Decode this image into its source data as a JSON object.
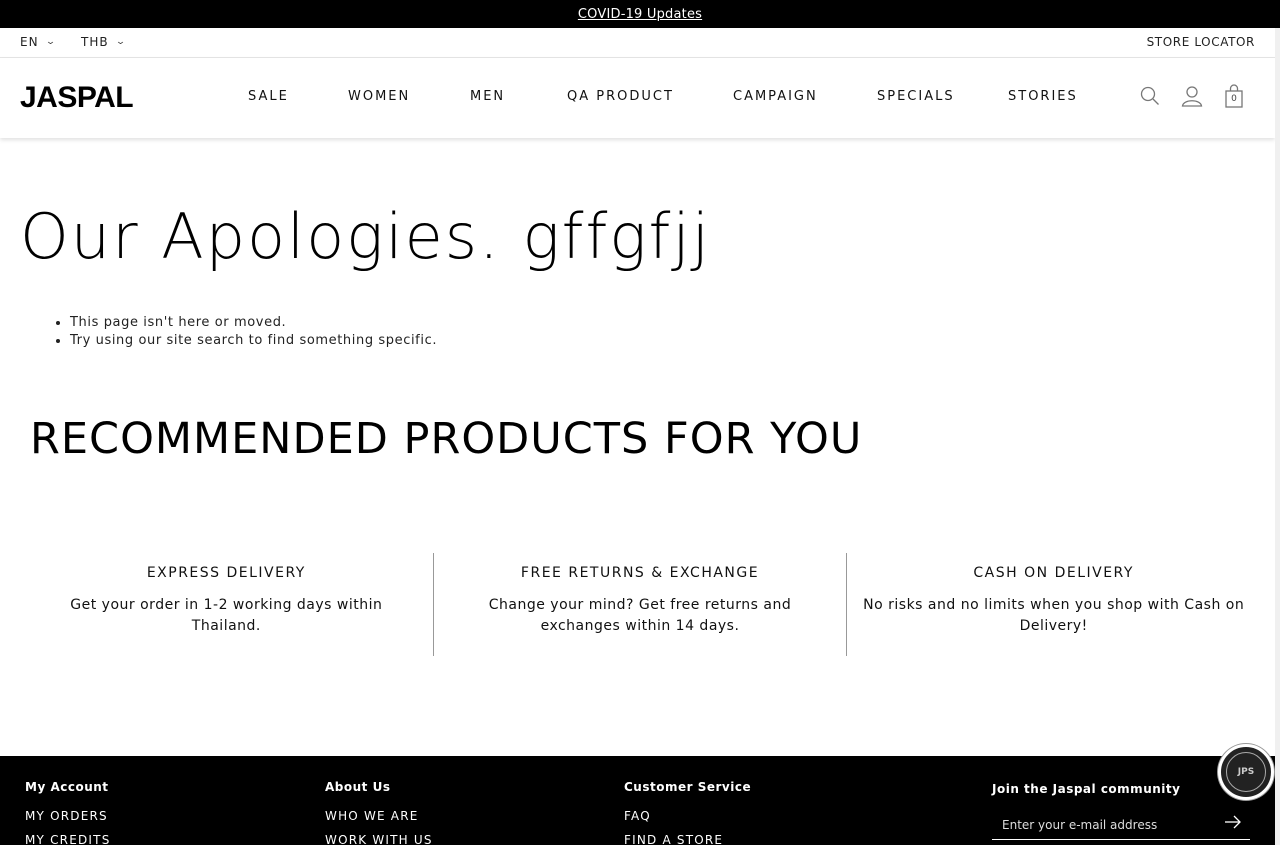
{
  "announcement": {
    "text": "COVID-19 Updates"
  },
  "utility": {
    "language": "EN",
    "currency": "THB",
    "store_locator": "STORE LOCATOR"
  },
  "header": {
    "logo": "JASPAL",
    "nav": [
      "SALE",
      "WOMEN",
      "MEN",
      "QA PRODUCT",
      "CAMPAIGN",
      "SPECIALS",
      "STORIES"
    ],
    "cart_count": "0",
    "icons": [
      "search-icon",
      "account-icon",
      "shopping-bag-icon"
    ]
  },
  "main": {
    "title": "Our Apologies. gffgfjj",
    "bullets": [
      "This page isn't here or moved.",
      "Try using our site search to find something specific."
    ],
    "recommended_title": "RECOMMENDED PRODUCTS FOR YOU"
  },
  "features": [
    {
      "title": "EXPRESS DELIVERY",
      "text": "Get your order in 1-2 working days within Thailand."
    },
    {
      "title": "FREE RETURNS & EXCHANGE",
      "text": "Change your mind? Get free returns and exchanges within 14 days."
    },
    {
      "title": "CASH ON DELIVERY",
      "text": "No risks and no limits when you shop with Cash on Delivery!"
    }
  ],
  "footer": {
    "columns": [
      {
        "heading": "My Account",
        "links": [
          "MY ORDERS",
          "MY CREDITS"
        ]
      },
      {
        "heading": "About Us",
        "links": [
          "WHO WE ARE",
          "WORK WITH US"
        ]
      },
      {
        "heading": "Customer Service",
        "links": [
          "FAQ",
          "FIND A STORE"
        ]
      }
    ],
    "join_heading": "Join the Jaspal community",
    "email_placeholder": "Enter your e-mail address"
  },
  "chat": {
    "label": "JPS"
  }
}
